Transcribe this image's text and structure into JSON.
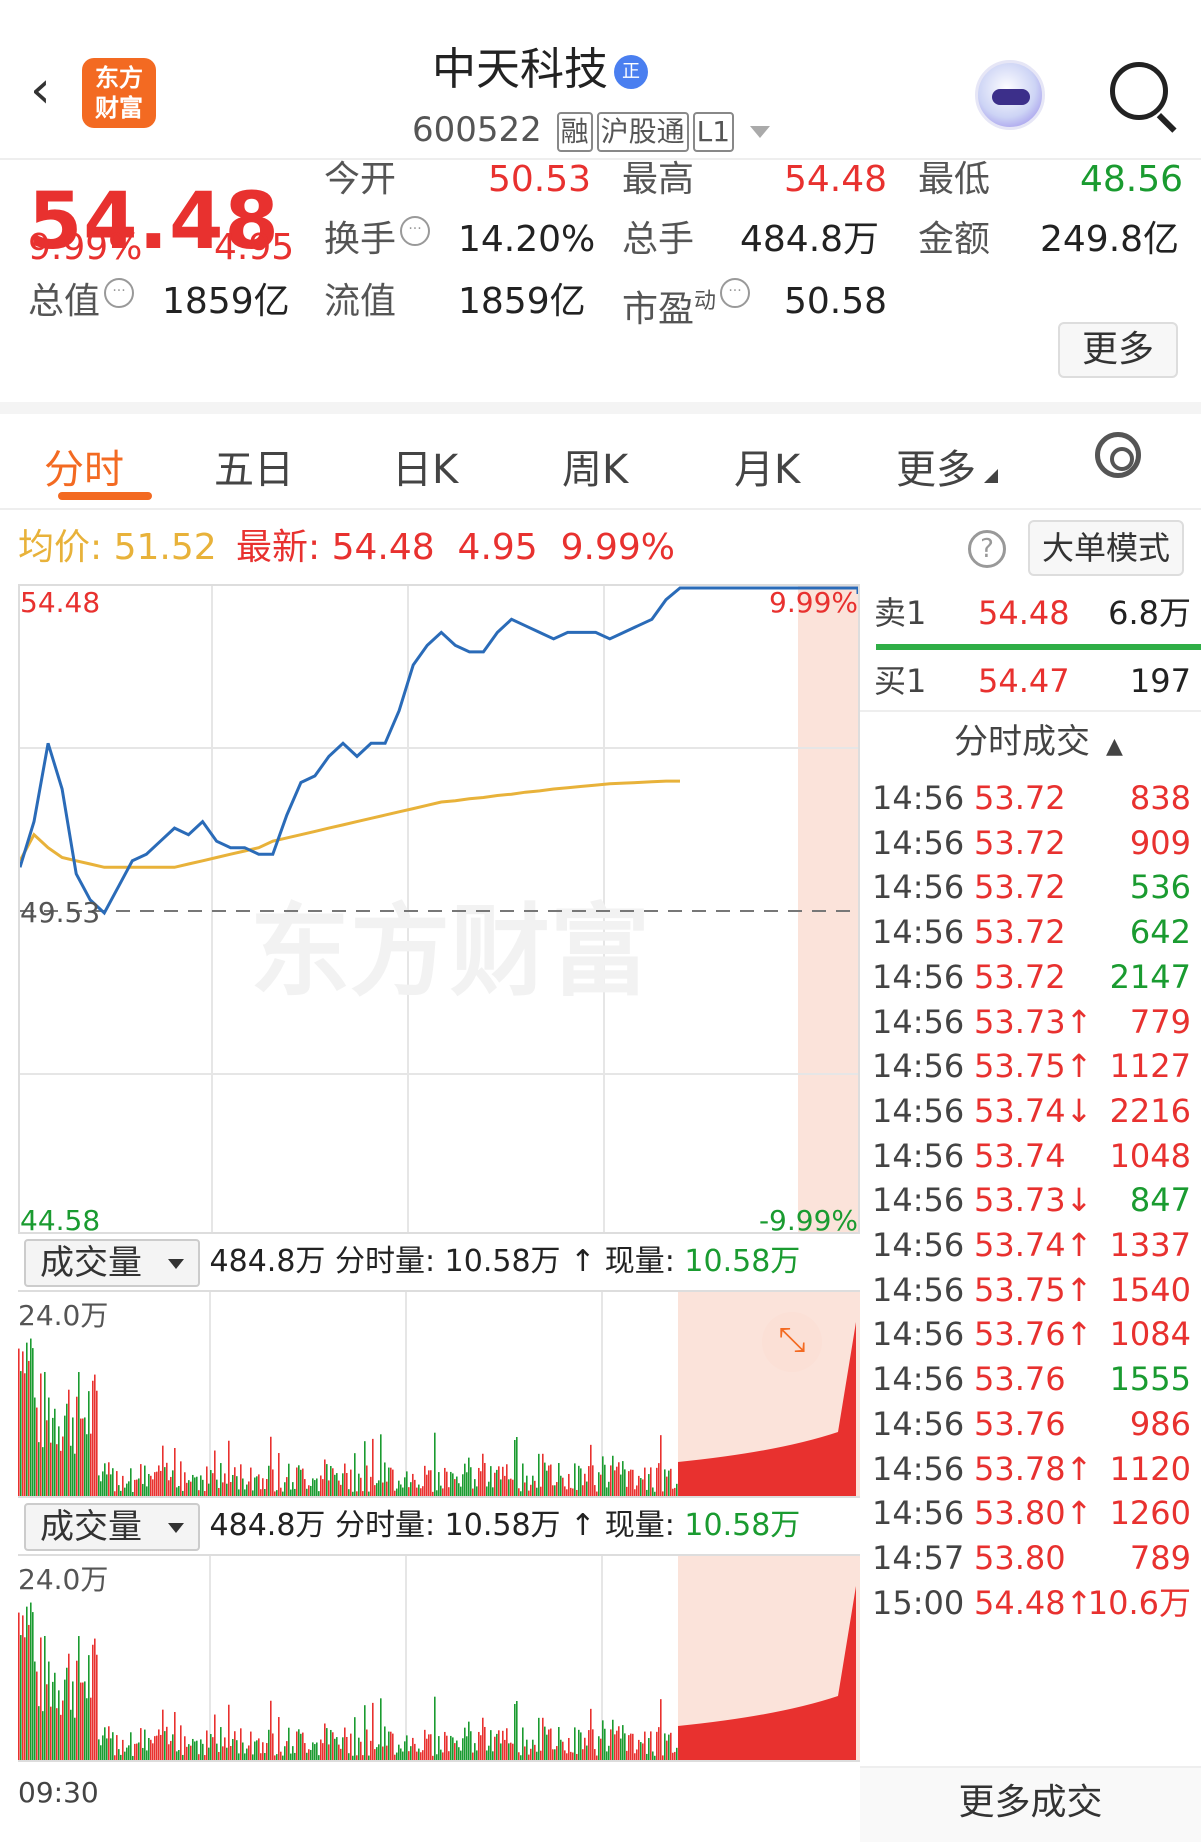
{
  "header": {
    "back_icon": "chevron-left-icon",
    "logo_text": "东方\n财富",
    "stock_name": "中天科技",
    "badge": "正",
    "code": "600522",
    "tags": [
      "融",
      "沪股通",
      "L1"
    ],
    "assistant_icon": "robot-avatar-icon",
    "search_icon": "search-icon"
  },
  "quote": {
    "price": "54.48",
    "change_pct": "9.99%",
    "change": "4.95",
    "open_label": "今开",
    "open": "50.53",
    "high_label": "最高",
    "high": "54.48",
    "low_label": "最低",
    "low": "48.56",
    "turnover_label": "换手",
    "turnover": "14.20%",
    "volume_label": "总手",
    "volume": "484.8万",
    "amount_label": "金额",
    "amount": "249.8亿",
    "mktcap_label": "总值",
    "mktcap": "1859亿",
    "float_label": "流值",
    "float": "1859亿",
    "pe_label": "市盈",
    "pe_sup": "动",
    "pe": "50.58",
    "more": "更多"
  },
  "tabs": [
    "分时",
    "五日",
    "日K",
    "周K",
    "月K",
    "更多"
  ],
  "info_bar": {
    "avg_label": "均价:",
    "avg": "51.52",
    "latest_label": "最新:",
    "latest": "54.48",
    "chg": "4.95",
    "pct": "9.99%",
    "help": "?",
    "mode": "大单模式"
  },
  "chart_data": {
    "type": "line",
    "title": "",
    "ylim": [
      44.58,
      54.48
    ],
    "prev_close": 49.53,
    "y_top_label": "54.48",
    "y_mid_label": "49.53",
    "y_bot_label": "44.58",
    "pct_top_label": "9.99%",
    "pct_bot_label": "-9.99%",
    "watermark": "东方财富",
    "series": [
      {
        "color": "#2a6bb8",
        "values": [
          50.2,
          50.9,
          52.1,
          51.4,
          50.1,
          49.7,
          49.5,
          49.9,
          50.3,
          50.4,
          50.6,
          50.8,
          50.7,
          50.9,
          50.6,
          50.5,
          50.5,
          50.4,
          50.4,
          51.0,
          51.5,
          51.6,
          51.9,
          52.1,
          51.9,
          52.1,
          52.1,
          52.6,
          53.3,
          53.6,
          53.8,
          53.6,
          53.5,
          53.5,
          53.8,
          54.0,
          53.9,
          53.8,
          53.7,
          53.8,
          53.8,
          53.8,
          53.7,
          53.8,
          53.9,
          54.0,
          54.3,
          54.48
        ]
      },
      {
        "color": "#e8b23a",
        "values": [
          50.3,
          50.7,
          50.5,
          50.35,
          50.3,
          50.25,
          50.2,
          50.2,
          50.2,
          50.2,
          50.2,
          50.2,
          50.25,
          50.3,
          50.35,
          50.4,
          50.45,
          50.5,
          50.6,
          50.65,
          50.7,
          50.75,
          50.8,
          50.85,
          50.9,
          50.95,
          51.0,
          51.05,
          51.1,
          51.15,
          51.2,
          51.22,
          51.25,
          51.27,
          51.3,
          51.32,
          51.35,
          51.37,
          51.4,
          51.42,
          51.44,
          51.46,
          51.48,
          51.49,
          51.5,
          51.51,
          51.52,
          51.52
        ]
      }
    ]
  },
  "volume_panel": {
    "selector": "成交量",
    "total": "484.8万",
    "minute_label": "分时量:",
    "minute": "10.58万",
    "arrow": "↑",
    "now_label": "现量:",
    "now": "10.58万",
    "ymax_label": "24.0万",
    "expand_icon": "expand-arrows-icon"
  },
  "order_book": {
    "sell": {
      "label": "卖1",
      "price": "54.48",
      "vol": "6.8万"
    },
    "buy": {
      "label": "买1",
      "price": "54.47",
      "vol": "197"
    }
  },
  "trades_title": "分时成交",
  "trades": [
    {
      "t": "14:56",
      "p": "53.72",
      "d": "",
      "v": "838",
      "c": "red"
    },
    {
      "t": "14:56",
      "p": "53.72",
      "d": "",
      "v": "909",
      "c": "red"
    },
    {
      "t": "14:56",
      "p": "53.72",
      "d": "",
      "v": "536",
      "c": "green"
    },
    {
      "t": "14:56",
      "p": "53.72",
      "d": "",
      "v": "642",
      "c": "green"
    },
    {
      "t": "14:56",
      "p": "53.72",
      "d": "",
      "v": "2147",
      "c": "green"
    },
    {
      "t": "14:56",
      "p": "53.73",
      "d": "↑",
      "v": "779",
      "c": "red"
    },
    {
      "t": "14:56",
      "p": "53.75",
      "d": "↑",
      "v": "1127",
      "c": "red"
    },
    {
      "t": "14:56",
      "p": "53.74",
      "d": "↓",
      "v": "2216",
      "c": "red"
    },
    {
      "t": "14:56",
      "p": "53.74",
      "d": "",
      "v": "1048",
      "c": "red"
    },
    {
      "t": "14:56",
      "p": "53.73",
      "d": "↓",
      "v": "847",
      "c": "green"
    },
    {
      "t": "14:56",
      "p": "53.74",
      "d": "↑",
      "v": "1337",
      "c": "red"
    },
    {
      "t": "14:56",
      "p": "53.75",
      "d": "↑",
      "v": "1540",
      "c": "red"
    },
    {
      "t": "14:56",
      "p": "53.76",
      "d": "↑",
      "v": "1084",
      "c": "red"
    },
    {
      "t": "14:56",
      "p": "53.76",
      "d": "",
      "v": "1555",
      "c": "green"
    },
    {
      "t": "14:56",
      "p": "53.76",
      "d": "",
      "v": "986",
      "c": "red"
    },
    {
      "t": "14:56",
      "p": "53.78",
      "d": "↑",
      "v": "1120",
      "c": "red"
    },
    {
      "t": "14:56",
      "p": "53.80",
      "d": "↑",
      "v": "1260",
      "c": "red"
    },
    {
      "t": "14:57",
      "p": "53.80",
      "d": "",
      "v": "789",
      "c": "red"
    },
    {
      "t": "15:00",
      "p": "54.48",
      "d": "↑",
      "v": "10.6万",
      "c": "red"
    }
  ],
  "time_start": "09:30",
  "more_trades": "更多成交",
  "colors": {
    "up": "#e8312f",
    "down": "#1a9b30",
    "accent": "#f36a22",
    "price_line": "#2a6bb8",
    "avg_line": "#e8b23a"
  }
}
